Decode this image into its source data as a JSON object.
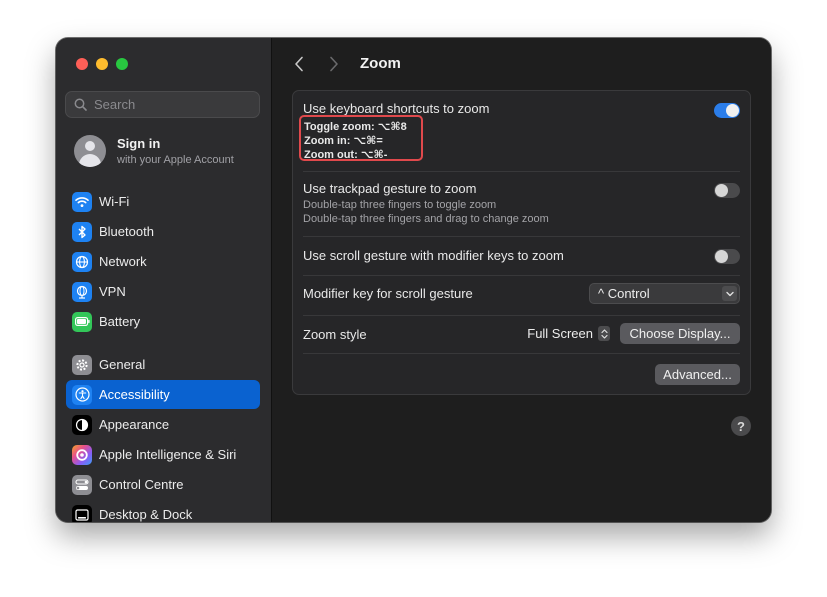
{
  "window": {
    "title": "Zoom"
  },
  "sidebar": {
    "search_placeholder": "Search",
    "account": {
      "title": "Sign in",
      "subtitle": "with your Apple Account"
    },
    "items": [
      {
        "label": "Wi-Fi",
        "icon": "wifi-icon",
        "color": "#1e82f2"
      },
      {
        "label": "Bluetooth",
        "icon": "bluetooth-icon",
        "color": "#1e82f2"
      },
      {
        "label": "Network",
        "icon": "globe-icon",
        "color": "#1e82f2"
      },
      {
        "label": "VPN",
        "icon": "vpn-globe-icon",
        "color": "#1e82f2"
      },
      {
        "label": "Battery",
        "icon": "battery-icon",
        "color": "#33c759"
      },
      {
        "label": "General",
        "icon": "gear-icon",
        "color": "#8e8e93"
      },
      {
        "label": "Accessibility",
        "icon": "accessibility-icon",
        "color": "#1e82f2",
        "active": true
      },
      {
        "label": "Appearance",
        "icon": "appearance-icon",
        "color": "#1c1c1e"
      },
      {
        "label": "Apple Intelligence & Siri",
        "icon": "siri-icon",
        "color": "#c050e0"
      },
      {
        "label": "Control Centre",
        "icon": "control-centre-icon",
        "color": "#8e8e93"
      },
      {
        "label": "Desktop & Dock",
        "icon": "desktop-dock-icon",
        "color": "#1c1c1e"
      }
    ]
  },
  "main": {
    "keyboard": {
      "label": "Use keyboard shortcuts to zoom",
      "enabled": true,
      "shortcuts": [
        "Toggle zoom: ⌥⌘8",
        "Zoom in: ⌥⌘=",
        "Zoom out: ⌥⌘-"
      ]
    },
    "trackpad": {
      "label": "Use trackpad gesture to zoom",
      "desc1": "Double-tap three fingers to toggle zoom",
      "desc2": "Double-tap three fingers and drag to change zoom",
      "enabled": false
    },
    "scroll": {
      "label": "Use scroll gesture with modifier keys to zoom",
      "enabled": false
    },
    "modifier": {
      "label": "Modifier key for scroll gesture",
      "value": "^ Control"
    },
    "zoom_style": {
      "label": "Zoom style",
      "value": "Full Screen",
      "choose_button": "Choose Display..."
    },
    "advanced_button": "Advanced...",
    "help_label": "?"
  },
  "colors": {
    "accent": "#0a62d0",
    "toggle_on": "#2b7de9",
    "highlight_border": "#e0494c"
  }
}
